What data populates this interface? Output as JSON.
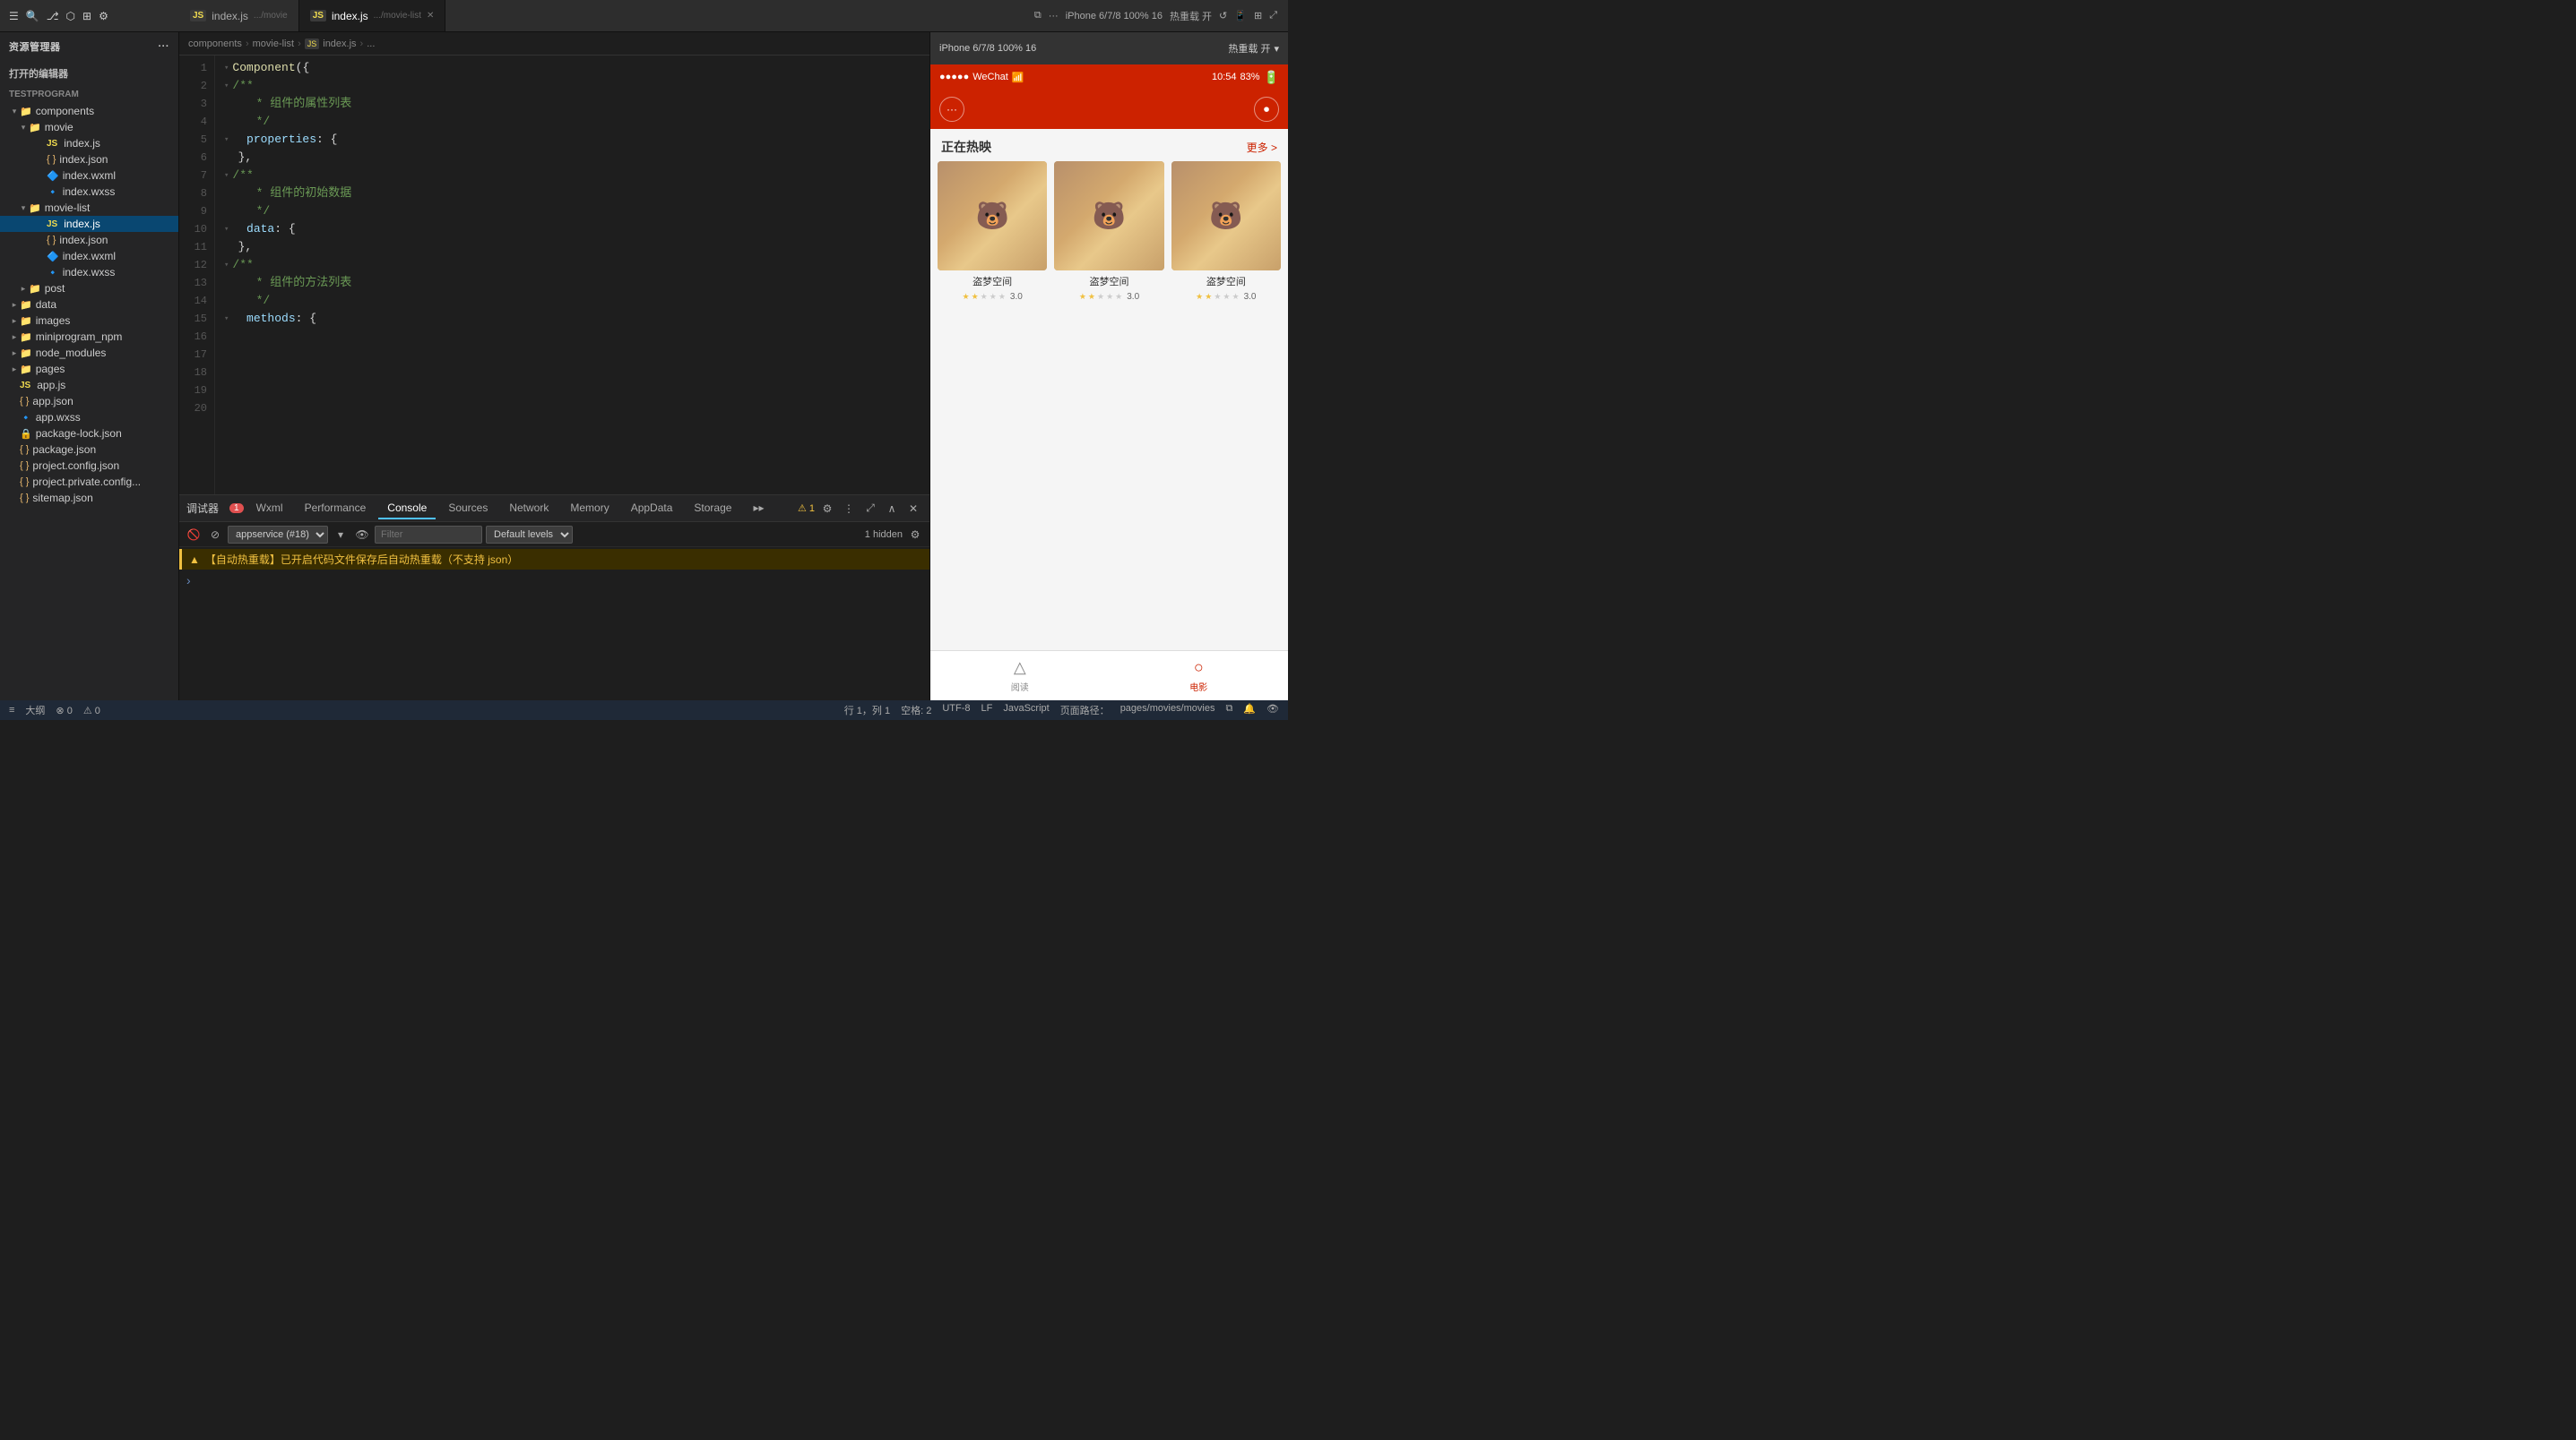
{
  "topbar": {
    "tabs": [
      {
        "id": "tab1",
        "icon": "JS",
        "name": "index.js",
        "path": ".../movie",
        "active": false,
        "closeable": false
      },
      {
        "id": "tab2",
        "icon": "JS",
        "name": "index.js",
        "path": ".../movie-list",
        "active": true,
        "closeable": true
      }
    ],
    "device": "iPhone 6/7/8 100% 16",
    "hotreload": "热重载 开"
  },
  "sidebar": {
    "header": "资源管理器",
    "section_open": "打开的编辑器",
    "project": "TESTPROGRAM",
    "tree": [
      {
        "id": "components",
        "label": "components",
        "type": "folder",
        "level": 1,
        "expanded": true
      },
      {
        "id": "movie",
        "label": "movie",
        "type": "folder",
        "level": 2,
        "expanded": true
      },
      {
        "id": "movie-index-js",
        "label": "index.js",
        "type": "js",
        "level": 3,
        "active": false
      },
      {
        "id": "movie-index-json",
        "label": "index.json",
        "type": "json",
        "level": 3
      },
      {
        "id": "movie-index-wxml",
        "label": "index.wxml",
        "type": "wxml",
        "level": 3
      },
      {
        "id": "movie-index-wxss",
        "label": "index.wxss",
        "type": "wxss",
        "level": 3
      },
      {
        "id": "movie-list",
        "label": "movie-list",
        "type": "folder",
        "level": 2,
        "expanded": true
      },
      {
        "id": "movielist-index-js",
        "label": "index.js",
        "type": "js",
        "level": 3,
        "active": true
      },
      {
        "id": "movielist-index-json",
        "label": "index.json",
        "type": "json",
        "level": 3
      },
      {
        "id": "movielist-index-wxml",
        "label": "index.wxml",
        "type": "wxml",
        "level": 3
      },
      {
        "id": "movielist-index-wxss",
        "label": "index.wxss",
        "type": "wxss",
        "level": 3
      },
      {
        "id": "post",
        "label": "post",
        "type": "folder",
        "level": 2
      },
      {
        "id": "data",
        "label": "data",
        "type": "folder",
        "level": 1
      },
      {
        "id": "images",
        "label": "images",
        "type": "folder",
        "level": 1
      },
      {
        "id": "miniprogram_npm",
        "label": "miniprogram_npm",
        "type": "folder",
        "level": 1
      },
      {
        "id": "node_modules",
        "label": "node_modules",
        "type": "folder",
        "level": 1
      },
      {
        "id": "pages",
        "label": "pages",
        "type": "folder",
        "level": 1
      },
      {
        "id": "app-js",
        "label": "app.js",
        "type": "js",
        "level": 1
      },
      {
        "id": "app-json",
        "label": "app.json",
        "type": "json",
        "level": 1
      },
      {
        "id": "app-wxss",
        "label": "app.wxss",
        "type": "wxss",
        "level": 1
      },
      {
        "id": "package-lock",
        "label": "package-lock.json",
        "type": "json",
        "level": 1
      },
      {
        "id": "package-json",
        "label": "package.json",
        "type": "json",
        "level": 1
      },
      {
        "id": "project-config",
        "label": "project.config.json",
        "type": "json",
        "level": 1
      },
      {
        "id": "project-private",
        "label": "project.private.config...",
        "type": "json",
        "level": 1
      },
      {
        "id": "sitemap",
        "label": "sitemap.json",
        "type": "json",
        "level": 1
      }
    ]
  },
  "breadcrumb": {
    "parts": [
      "components",
      ">",
      "movie-list",
      ">",
      "JS",
      "index.js",
      ">",
      "..."
    ]
  },
  "editor": {
    "lines": [
      {
        "num": 1,
        "foldable": true,
        "code": "Component({"
      },
      {
        "num": 2,
        "foldable": true,
        "code": "  /**"
      },
      {
        "num": 3,
        "code": "   * 组件的属性列表"
      },
      {
        "num": 4,
        "code": "   */"
      },
      {
        "num": 5,
        "foldable": true,
        "code": "  properties: {"
      },
      {
        "num": 6,
        "code": ""
      },
      {
        "num": 7,
        "code": "  },"
      },
      {
        "num": 8,
        "code": ""
      },
      {
        "num": 9,
        "foldable": true,
        "code": "  /**"
      },
      {
        "num": 10,
        "code": "   * 组件的初始数据"
      },
      {
        "num": 11,
        "code": "   */"
      },
      {
        "num": 12,
        "foldable": true,
        "code": "  data: {"
      },
      {
        "num": 13,
        "code": ""
      },
      {
        "num": 14,
        "code": "  },"
      },
      {
        "num": 15,
        "code": ""
      },
      {
        "num": 16,
        "foldable": true,
        "code": "  /**"
      },
      {
        "num": 17,
        "code": "   * 组件的方法列表"
      },
      {
        "num": 18,
        "code": "   */"
      },
      {
        "num": 19,
        "foldable": true,
        "code": "  methods: {"
      },
      {
        "num": 20,
        "code": ""
      }
    ]
  },
  "debugger": {
    "header_label": "调试器",
    "badge": "1",
    "tabs": [
      {
        "id": "wxml",
        "label": "Wxml",
        "active": false
      },
      {
        "id": "performance",
        "label": "Performance",
        "active": false
      },
      {
        "id": "console",
        "label": "Console",
        "active": true
      },
      {
        "id": "sources",
        "label": "Sources",
        "active": false
      },
      {
        "id": "network",
        "label": "Network",
        "active": false
      },
      {
        "id": "memory",
        "label": "Memory",
        "active": false
      },
      {
        "id": "appdata",
        "label": "AppData",
        "active": false
      },
      {
        "id": "storage",
        "label": "Storage",
        "active": false
      },
      {
        "id": "more",
        "label": "▸▸",
        "active": false
      }
    ],
    "toolbar": {
      "filter_placeholder": "Filter",
      "levels_label": "Default levels",
      "hidden_count": "1 hidden"
    },
    "console_messages": [
      {
        "type": "warning",
        "text": "【自动热重载】已开启代码文件保存后自动热重载（不支持 json）"
      }
    ],
    "service_label": "appservice (#18)"
  },
  "preview": {
    "device_label": "iPhone 6/7/8 100% 16",
    "hotreload_label": "热重载 开",
    "status_bar": {
      "signal": "●●●●●",
      "carrier": "WeChat",
      "wifi": "WiFi",
      "time": "10:54",
      "battery": "83%"
    },
    "header": {
      "title": "正在热映",
      "more": "更多 >"
    },
    "movies": [
      {
        "id": "m1",
        "title": "盗梦空间",
        "rating": "3.0",
        "stars": 2
      },
      {
        "id": "m2",
        "title": "盗梦空间",
        "rating": "3.0",
        "stars": 2
      },
      {
        "id": "m3",
        "title": "盗梦空间",
        "rating": "3.0",
        "stars": 2
      }
    ],
    "nav_items": [
      {
        "id": "reading",
        "icon": "△",
        "label": "阅读",
        "active": false
      },
      {
        "id": "movie",
        "icon": "○",
        "label": "电影",
        "active": true
      }
    ]
  },
  "statusbar": {
    "position": "行 1，列 1",
    "spaces": "空格: 2",
    "encoding": "UTF-8",
    "line_ending": "LF",
    "language": "JavaScript",
    "path_label": "页面路径：",
    "path": "pages/movies/movies",
    "errors": "0",
    "warnings": "0",
    "outline_label": "大纲"
  }
}
